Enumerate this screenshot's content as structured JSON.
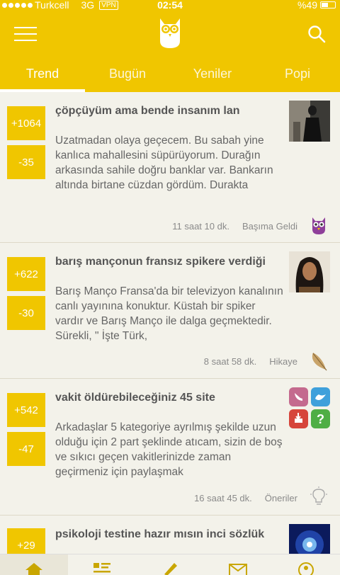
{
  "status": {
    "carrier": "Turkcell",
    "network": "3G",
    "vpn": "VPN",
    "time": "02:54",
    "battery": "%49",
    "battery_level": 0.49
  },
  "header": {
    "menu_icon": "hamburger-icon",
    "logo_icon": "owl-logo-icon",
    "search_icon": "search-icon"
  },
  "tabs": [
    {
      "label": "Trend"
    },
    {
      "label": "Bugün"
    },
    {
      "label": "Yeniler"
    },
    {
      "label": "Popi"
    }
  ],
  "posts": [
    {
      "upvotes": "+1064",
      "downvotes": "-35",
      "title": "çöpçüyüm ama bende insanım lan",
      "excerpt": "Uzatmadan olaya geçecem. Bu sabah yine kanlıca mahallesini süpürüyorum. Durağın arkasında sahile doğru banklar var. Bankarın altında birtane cüzdan gördüm. Durakta",
      "time": "11 saat 10 dk.",
      "category": "Başıma Geldi",
      "category_icon": "owl-badge-icon"
    },
    {
      "upvotes": "+622",
      "downvotes": "-30",
      "title": "barış mançonun fransız spikere verdiği",
      "excerpt": "Barış Manço Fransa'da bir televizyon kanalının canlı yayınına konuktur. Küstah bir spiker vardır ve Barış Manço ile dalga geçmektedir. Sürekli, \" İşte Türk,",
      "time": "8 saat 58 dk.",
      "category": "Hikaye",
      "category_icon": "feather-icon"
    },
    {
      "upvotes": "+542",
      "downvotes": "-47",
      "title": "vakit öldürebileceğiniz 45 site",
      "excerpt": "Arkadaşlar 5 kategoriye ayrılmış şekilde uzun olduğu için 2 part şeklinde atıcam, sizin de boş ve sıkıcı geçen vakitlerinizde zaman geçirmeniz için paylaşmak",
      "time": "16 saat 45 dk.",
      "category": "Öneriler",
      "category_icon": "lightbulb-icon"
    },
    {
      "upvotes": "+29",
      "title": "psikoloji testine hazır mısın inci sözlük"
    }
  ],
  "tabbar": [
    {
      "icon": "home-icon"
    },
    {
      "icon": "list-icon"
    },
    {
      "icon": "pen-icon"
    },
    {
      "icon": "mail-icon"
    },
    {
      "icon": "profile-icon"
    }
  ],
  "colors": {
    "accent": "#f0c600",
    "background": "#f3f2ea"
  }
}
